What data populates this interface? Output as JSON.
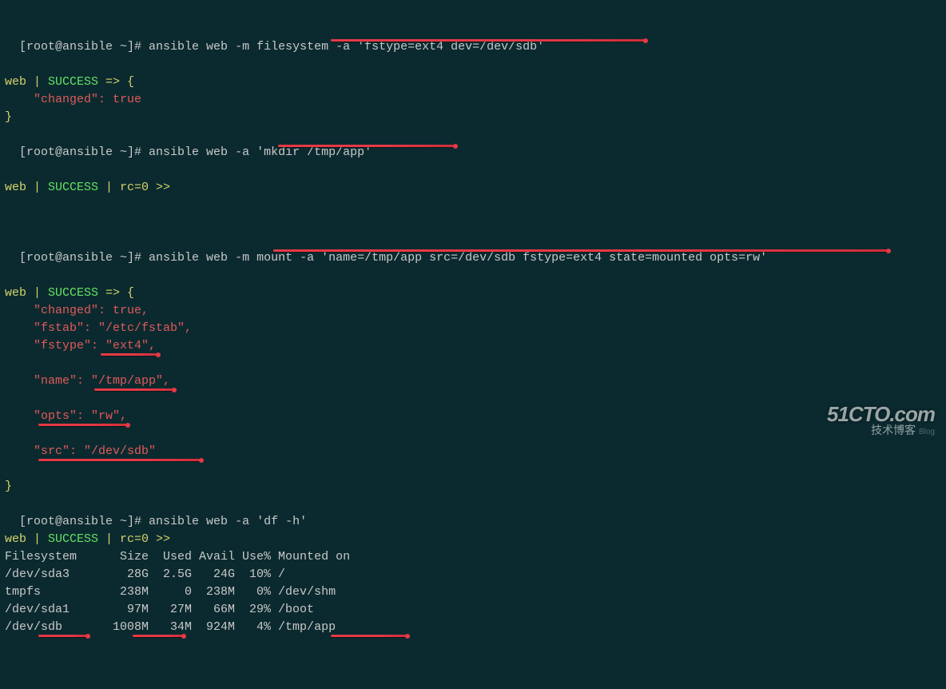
{
  "trunc": "                                        ",
  "prompt": "[root@ansible ~]# ",
  "cmd1": {
    "text": "ansible web -m filesystem -a 'fstype=ext4 dev=/dev/sdb'",
    "result_head": "web | SUCCESS => {",
    "changed": "    \"changed\": true",
    "close": "}"
  },
  "cmd2": {
    "text": "ansible web -a 'mkdir /tmp/app'",
    "result_head": "web | SUCCESS | rc=0 >>"
  },
  "cmd3": {
    "text": "ansible web -m mount -a 'name=/tmp/app src=/dev/sdb fstype=ext4 state=mounted opts=rw'",
    "result_head": "web | SUCCESS => {",
    "kv": {
      "changed": "    \"changed\": true,",
      "fstab": "    \"fstab\": \"/etc/fstab\",",
      "fstype": "    \"fstype\": \"ext4\",",
      "name": "    \"name\": \"/tmp/app\",",
      "opts": "    \"opts\": \"rw\",",
      "src": "    \"src\": \"/dev/sdb\""
    },
    "close": "}"
  },
  "cmd4": {
    "text": "ansible web -a 'df -h'",
    "result_head": "web | SUCCESS | rc=0 >>",
    "df": {
      "hdr": "Filesystem      Size  Used Avail Use% Mounted on",
      "r1": "/dev/sda3        28G  2.5G   24G  10% /",
      "r2": "tmpfs           238M     0  238M   0% /dev/shm",
      "r3": "/dev/sda1        97M   27M   66M  29% /boot",
      "r4": "/dev/sdb       1008M   34M  924M   4% /tmp/app"
    }
  },
  "watermark": {
    "big": "51CTO.com",
    "small": "技术博客",
    "blog": "Blog"
  }
}
